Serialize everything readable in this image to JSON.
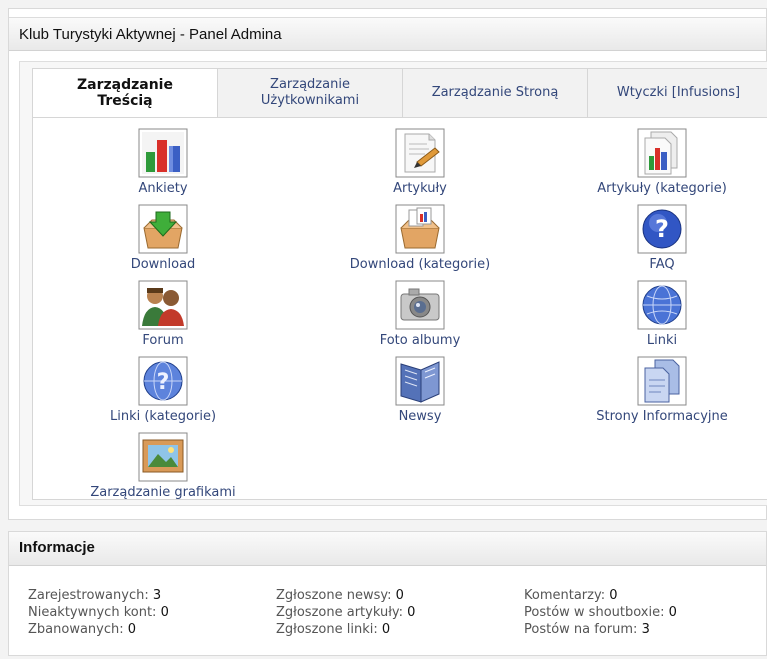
{
  "panel": {
    "title": "Klub Turystyki Aktywnej - Panel Admina"
  },
  "tabs": [
    {
      "line1": "Zarządzanie",
      "line2": "Treścią",
      "active": true
    },
    {
      "line1": "Zarządzanie",
      "line2": "Użytkownikami",
      "active": false
    },
    {
      "line1": "Zarządzanie Stroną",
      "line2": "",
      "active": false
    },
    {
      "line1": "Wtyczki [Infusions]",
      "line2": "",
      "active": false
    }
  ],
  "admin_items": [
    {
      "label": "Ankiety",
      "icon": "poll-chart-icon"
    },
    {
      "label": "Artykuły",
      "icon": "article-pencil-icon"
    },
    {
      "label": "Artykuły (kategorie)",
      "icon": "article-categories-icon"
    },
    {
      "label": "Download",
      "icon": "download-box-icon"
    },
    {
      "label": "Download (kategorie)",
      "icon": "download-categories-icon"
    },
    {
      "label": "FAQ",
      "icon": "faq-question-icon"
    },
    {
      "label": "Forum",
      "icon": "forum-users-icon"
    },
    {
      "label": "Foto albumy",
      "icon": "camera-icon"
    },
    {
      "label": "Linki",
      "icon": "globe-icon"
    },
    {
      "label": "Linki (kategorie)",
      "icon": "globe-question-icon"
    },
    {
      "label": "Newsy",
      "icon": "news-book-icon"
    },
    {
      "label": "Strony Informacyjne",
      "icon": "pages-icon"
    },
    {
      "label": "Zarządzanie grafikami",
      "icon": "image-frame-icon"
    }
  ],
  "info": {
    "title": "Informacje",
    "col1": [
      {
        "label": "Zarejestrowanych:",
        "value": "3"
      },
      {
        "label": "Nieaktywnych kont:",
        "value": "0"
      },
      {
        "label": "Zbanowanych:",
        "value": "0"
      }
    ],
    "col2": [
      {
        "label": "Zgłoszone newsy:",
        "value": "0"
      },
      {
        "label": "Zgłoszone artykuły:",
        "value": "0"
      },
      {
        "label": "Zgłoszone linki:",
        "value": "0"
      }
    ],
    "col3": [
      {
        "label": "Komentarzy:",
        "value": "0"
      },
      {
        "label": "Postów w shoutboxie:",
        "value": "0"
      },
      {
        "label": "Postów na forum:",
        "value": "3"
      }
    ]
  },
  "colors": {
    "link": "#33477a",
    "header_bg": "#ececec",
    "text_gray": "#555555"
  }
}
